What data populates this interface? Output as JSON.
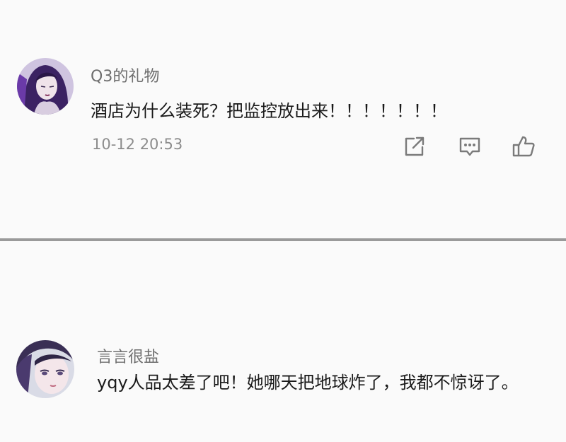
{
  "comments": [
    {
      "username": "Q3的礼物",
      "text": "酒店为什么装死？把监控放出来！！！！！！！",
      "time": "10-12  20:53",
      "actions": {
        "share_icon": "share-icon",
        "comment_icon": "comment-icon",
        "like_icon": "thumbs-up-icon"
      }
    },
    {
      "username": "言言很盐",
      "text": "yqy人品太差了吧！她哪天把地球炸了，我都不惊讶了。"
    }
  ],
  "colors": {
    "panel_bg": "#fafafa",
    "divider": "#9a9a9a",
    "username": "#6e6e6e",
    "text": "#1a1a1a",
    "timestamp": "#8c8c8c",
    "icon": "#7a7a7a"
  }
}
